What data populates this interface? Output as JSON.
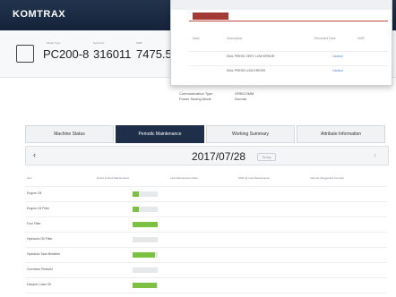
{
  "app": {
    "name": "KOMTRAX",
    "accent": "#1f2f4a",
    "alert_red": "#a33a36",
    "gauge_green": "#7dc142"
  },
  "machine": {
    "model_type_label": "Model Type",
    "serial_no_label": "Serial No.",
    "smr_label": "SMR",
    "model_type": "PC200-8",
    "serial_no": "316011",
    "smr": "7475.5"
  },
  "tabs": [
    {
      "label": "Machine Status"
    },
    {
      "label": "Periodic Maintenance"
    },
    {
      "label": "Working Summary"
    },
    {
      "label": "Attribute Information"
    }
  ],
  "date_nav": {
    "date": "2017/07/28",
    "today_label": "Today"
  },
  "table": {
    "headers": [
      "Item",
      "Hours to Next Maintenance",
      "Last Maintenance Date",
      "SMR @ Last Maintenance",
      "Interval (Suggested Interval)"
    ],
    "rows": [
      {
        "item": "Engine Oil",
        "fill": 0.25
      },
      {
        "item": "Engine Oil Filter",
        "fill": 0.25
      },
      {
        "item": "Fuel Filter",
        "fill": 1.0
      },
      {
        "item": "Hydraulic Oil Filter",
        "fill": 0.0
      },
      {
        "item": "Hydraulic Tank Breather",
        "fill": 0.9
      },
      {
        "item": "Corrosion Resistor",
        "fill": 0.0
      },
      {
        "item": "Damper Case Oil",
        "fill": 0.95
      },
      {
        "item": "Final Case Oil",
        "fill": 0.9
      }
    ]
  },
  "popup": {
    "headers": [
      "Date",
      "Description",
      "Recorded Date",
      "SMR"
    ],
    "rows": [
      {
        "description": "RAIL PRESS VERY LOW ERROR",
        "link": "Caution"
      },
      {
        "description": "RAIL PRESS LOW ERROR",
        "link": "Caution"
      }
    ]
  },
  "comm": {
    "type_label": "Communication Type",
    "type": "ORBCOMM",
    "power_label": "Power Saving Mode",
    "power": "Normal"
  }
}
